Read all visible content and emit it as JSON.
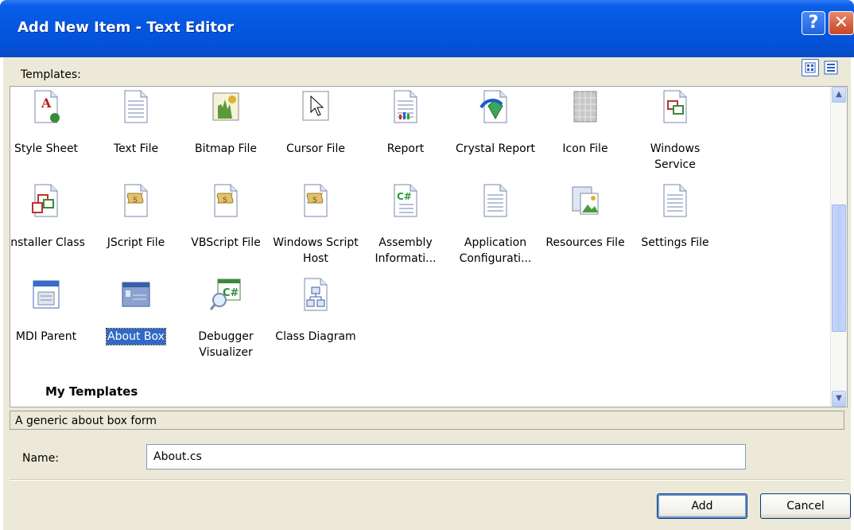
{
  "window": {
    "title": "Add New Item - Text Editor",
    "help_glyph": "?",
    "close_glyph": "✕"
  },
  "templates_label": "Templates:",
  "templates": [
    {
      "label": "Style Sheet",
      "icon": "style-sheet-icon"
    },
    {
      "label": "Text File",
      "icon": "text-file-icon"
    },
    {
      "label": "Bitmap File",
      "icon": "bitmap-file-icon"
    },
    {
      "label": "Cursor File",
      "icon": "cursor-file-icon"
    },
    {
      "label": "Report",
      "icon": "report-icon"
    },
    {
      "label": "Crystal Report",
      "icon": "crystal-report-icon"
    },
    {
      "label": "Icon File",
      "icon": "icon-file-icon"
    },
    {
      "label": "Windows Service",
      "icon": "windows-service-icon"
    },
    {
      "label": "Installer Class",
      "icon": "installer-class-icon"
    },
    {
      "label": "JScript File",
      "icon": "jscript-file-icon"
    },
    {
      "label": "VBScript File",
      "icon": "vbscript-file-icon"
    },
    {
      "label": "Windows Script Host",
      "icon": "windows-script-host-icon"
    },
    {
      "label": "Assembly Informati...",
      "icon": "assembly-info-icon"
    },
    {
      "label": "Application Configurati...",
      "icon": "app-config-icon"
    },
    {
      "label": "Resources File",
      "icon": "resources-file-icon"
    },
    {
      "label": "Settings File",
      "icon": "settings-file-icon"
    },
    {
      "label": "MDI Parent",
      "icon": "mdi-parent-icon"
    },
    {
      "label": "About Box",
      "icon": "about-box-icon",
      "selected": true
    },
    {
      "label": "Debugger Visualizer",
      "icon": "debugger-visualizer-icon"
    },
    {
      "label": "Class Diagram",
      "icon": "class-diagram-icon"
    }
  ],
  "my_templates_header": "My Templates",
  "description": "A generic about box form",
  "name_label": "Name:",
  "name_value": "About.cs",
  "buttons": {
    "add": "Add",
    "cancel": "Cancel"
  },
  "colors": {
    "titlebar": "#0456e0",
    "dialog_bg": "#ece9d8",
    "selection": "#316ac5"
  }
}
